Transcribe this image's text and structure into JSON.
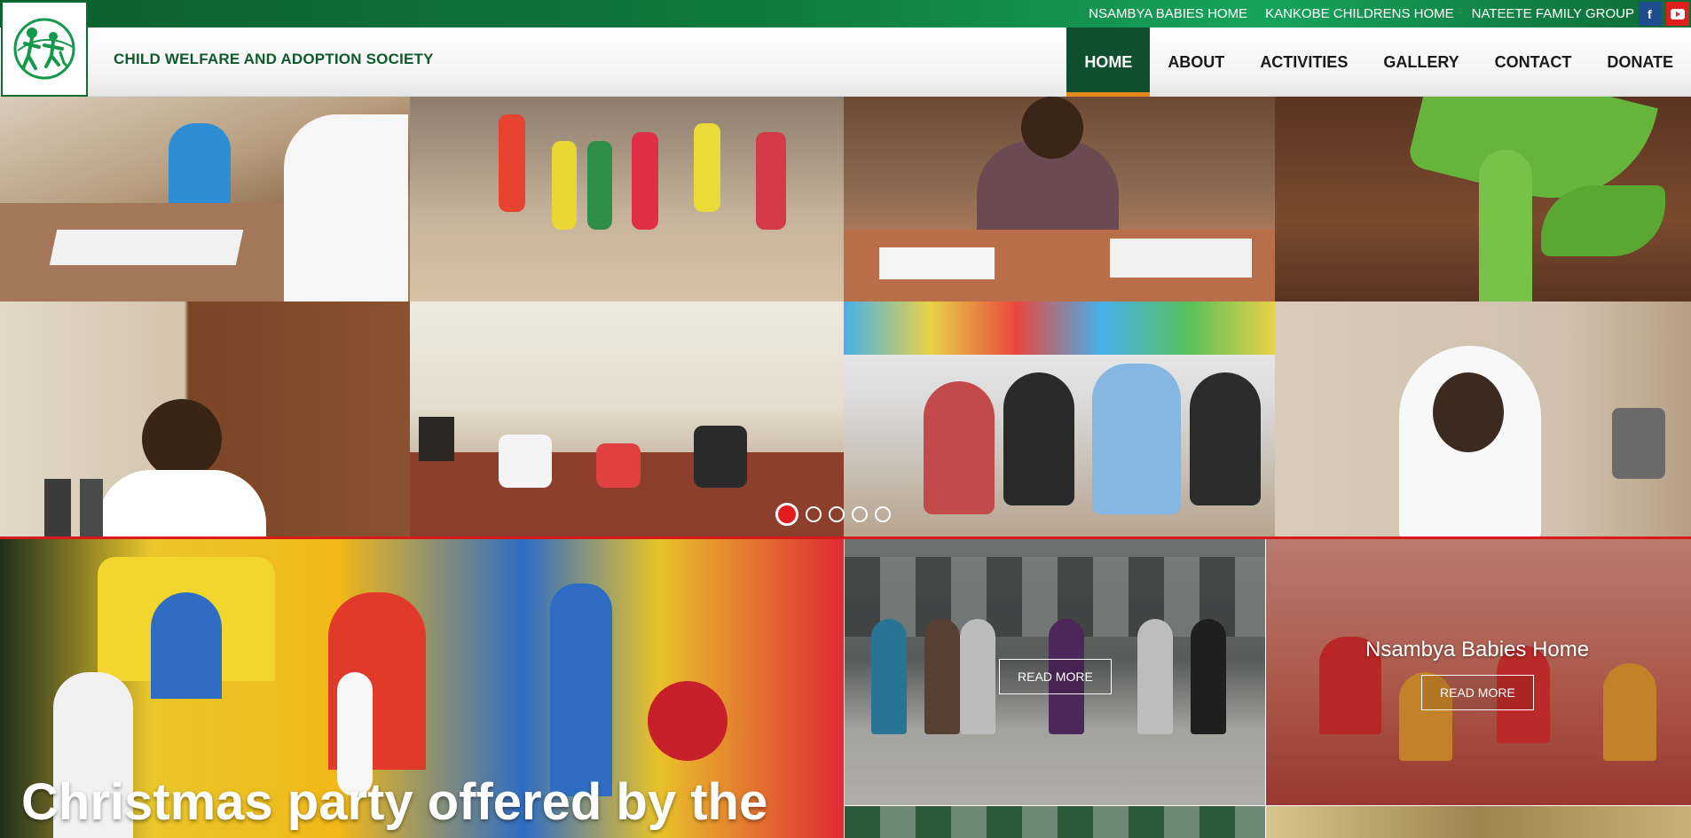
{
  "topbar": {
    "links": [
      "NSAMBYA BABIES HOME",
      "KANKOBE CHILDRENS HOME",
      "NATEETE FAMILY GROUP"
    ],
    "social": [
      {
        "name": "facebook",
        "glyph": "f",
        "color": "#1f4e8f"
      },
      {
        "name": "youtube",
        "glyph": "▶",
        "color": "#e01e1e"
      }
    ]
  },
  "header": {
    "site_title": "CHILD WELFARE AND ADOPTION SOCIETY",
    "nav": [
      "HOME",
      "ABOUT",
      "ACTIVITIES",
      "GALLERY",
      "CONTACT",
      "DONATE"
    ],
    "active_nav": "HOME",
    "accent_color": "#0f4f2e",
    "active_underline": "#e8891c"
  },
  "slider": {
    "slide_count": 5,
    "active_slide": 1,
    "dot_active_color": "#e31b1b"
  },
  "features": {
    "big_title": "Christmas party offered by the",
    "middle": {
      "button": "READ MORE"
    },
    "right": {
      "heading": "Nsambya Babies Home",
      "button": "READ MORE"
    }
  },
  "icons": [
    "logo-children-icon",
    "facebook-icon",
    "youtube-icon"
  ]
}
